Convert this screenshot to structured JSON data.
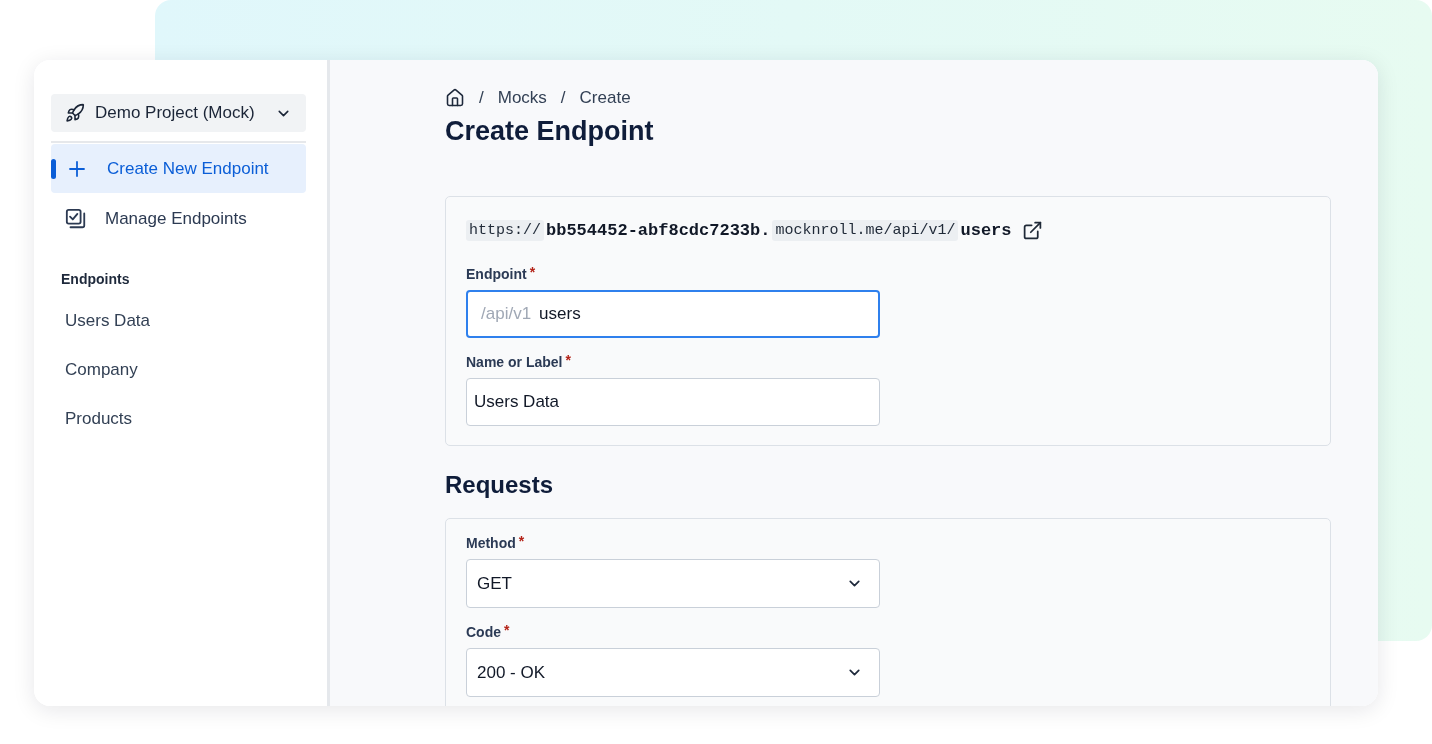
{
  "sidebar": {
    "project": {
      "label": "Demo Project (Mock)"
    },
    "nav": [
      {
        "kind": "create",
        "label": "Create New Endpoint",
        "selected": true
      },
      {
        "kind": "manage",
        "label": "Manage Endpoints",
        "selected": false
      }
    ],
    "section_title": "Endpoints",
    "endpoints": [
      {
        "label": "Users Data",
        "selected": false
      },
      {
        "label": "Company",
        "selected": false
      },
      {
        "label": "Products",
        "selected": false
      }
    ]
  },
  "breadcrumb": [
    {
      "kind": "home"
    },
    {
      "kind": "separator",
      "text": "/"
    },
    {
      "kind": "link",
      "text": "Mocks"
    },
    {
      "kind": "separator",
      "text": "/"
    },
    {
      "kind": "current",
      "text": "Create"
    }
  ],
  "title": "Create Endpoint",
  "endpoint_card": {
    "url": [
      {
        "kind": "code",
        "text": "https://"
      },
      {
        "kind": "bold",
        "text": "bb554452-abf8cdc7233b."
      },
      {
        "kind": "code",
        "text": "mocknroll.me/api/v1/"
      },
      {
        "kind": "bold",
        "text": "users"
      },
      {
        "kind": "open_link"
      }
    ],
    "fields": [
      {
        "kind": "text",
        "label": "Endpoint",
        "required_mark": "*",
        "prefix": "/api/v1",
        "value": "users",
        "focused": true
      },
      {
        "kind": "text",
        "label": "Name or Label",
        "required_mark": "*",
        "value": "Users Data",
        "focused": false
      }
    ]
  },
  "requests": {
    "title": "Requests",
    "fields": [
      {
        "kind": "select",
        "label": "Method",
        "required_mark": "*",
        "value": "GET"
      },
      {
        "kind": "select",
        "label": "Code",
        "required_mark": "*",
        "value": "200 - OK"
      }
    ]
  }
}
